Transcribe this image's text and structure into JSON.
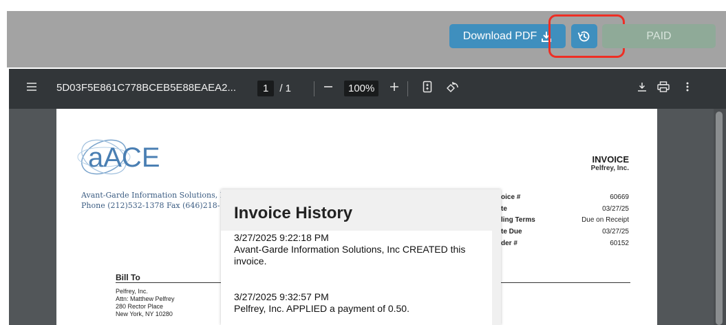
{
  "header": {
    "download_label": "Download PDF",
    "paid_label": "PAID"
  },
  "viewer": {
    "file_name": "5D03F5E861C778BCEB5E88EAEA2...",
    "page_current": "1",
    "page_total": "/ 1",
    "zoom": "100%"
  },
  "invoice": {
    "company_name": "Avant-Garde Information Solutions, I",
    "company_phone": "Phone (212)532-1378   Fax (646)218-",
    "logo_text": "aACE",
    "title": "INVOICE",
    "customer_name": "Pelfrey, Inc.",
    "meta": [
      {
        "label": "oice #",
        "value": "60669"
      },
      {
        "label": "te",
        "value": "03/27/25"
      },
      {
        "label": "ling Terms",
        "value": "Due on Receipt"
      },
      {
        "label": "te Due",
        "value": "03/27/25"
      },
      {
        "label": "der #",
        "value": "60152"
      }
    ],
    "bill_to_label": "Bill To",
    "bill_to_lines": [
      "Pelfrey, Inc.",
      "Attn: Matthew Pelfrey",
      "280 Rector Place",
      "New York, NY 10280"
    ]
  },
  "modal": {
    "title": "Invoice History",
    "entries": [
      {
        "timestamp": "3/27/2025 9:22:18 PM",
        "text": "Avant-Garde Information Solutions, Inc CREATED this invoice."
      },
      {
        "timestamp": "3/27/2025 9:32:57 PM",
        "text": "Pelfrey, Inc. APPLIED a payment of 0.50."
      }
    ]
  },
  "colors": {
    "accent_blue": "#3f8fbe",
    "paid_green": "#8faa98",
    "highlight_red": "#ee2e24"
  },
  "icons": [
    "download-icon",
    "history-icon",
    "menu-icon",
    "zoom-out-icon",
    "zoom-in-icon",
    "fit-page-icon",
    "rotate-icon",
    "print-icon",
    "more-vert-icon"
  ]
}
